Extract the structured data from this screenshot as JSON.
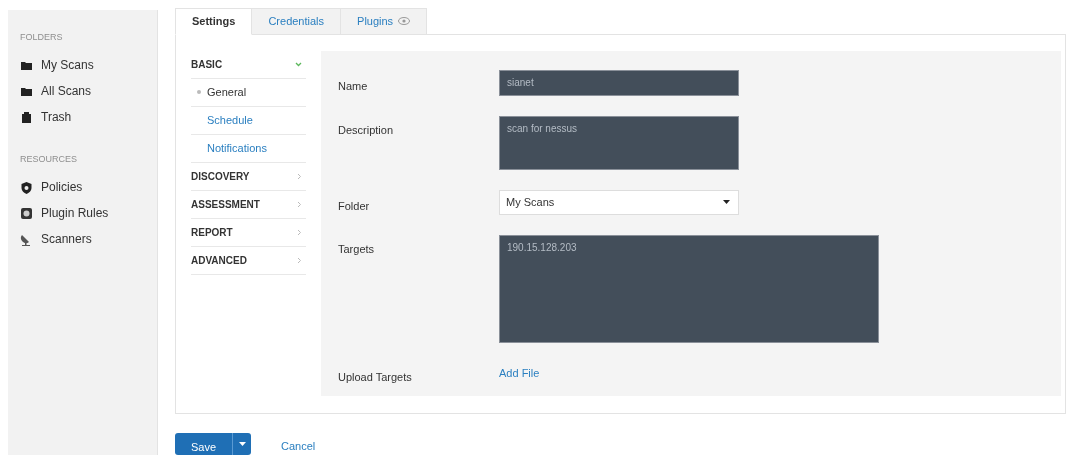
{
  "sidebar": {
    "sections": [
      {
        "heading": "FOLDERS",
        "items": [
          {
            "label": "My Scans"
          },
          {
            "label": "All Scans"
          },
          {
            "label": "Trash"
          }
        ]
      },
      {
        "heading": "RESOURCES",
        "items": [
          {
            "label": "Policies"
          },
          {
            "label": "Plugin Rules"
          },
          {
            "label": "Scanners"
          }
        ]
      }
    ]
  },
  "tabs": [
    {
      "label": "Settings",
      "selected": true
    },
    {
      "label": "Credentials",
      "selected": false
    },
    {
      "label": "Plugins",
      "selected": false
    }
  ],
  "nav": [
    {
      "label": "BASIC",
      "expanded": true,
      "children": [
        {
          "label": "General",
          "selected": true
        },
        {
          "label": "Schedule",
          "selected": false
        },
        {
          "label": "Notifications",
          "selected": false
        }
      ]
    },
    {
      "label": "DISCOVERY",
      "expanded": false
    },
    {
      "label": "ASSESSMENT",
      "expanded": false
    },
    {
      "label": "REPORT",
      "expanded": false
    },
    {
      "label": "ADVANCED",
      "expanded": false
    }
  ],
  "form": [
    {
      "label": "Name",
      "kind": "text",
      "value": "sianet"
    },
    {
      "label": "Description",
      "kind": "textarea",
      "value": "scan for nessus"
    },
    {
      "label": "Folder",
      "kind": "select",
      "value": "My Scans"
    },
    {
      "label": "Targets",
      "kind": "textarea-large",
      "value": "190.15.128.203"
    },
    {
      "label": "Upload Targets",
      "kind": "link",
      "value": "Add File"
    }
  ],
  "actions": {
    "save": "Save",
    "cancel": "Cancel"
  }
}
